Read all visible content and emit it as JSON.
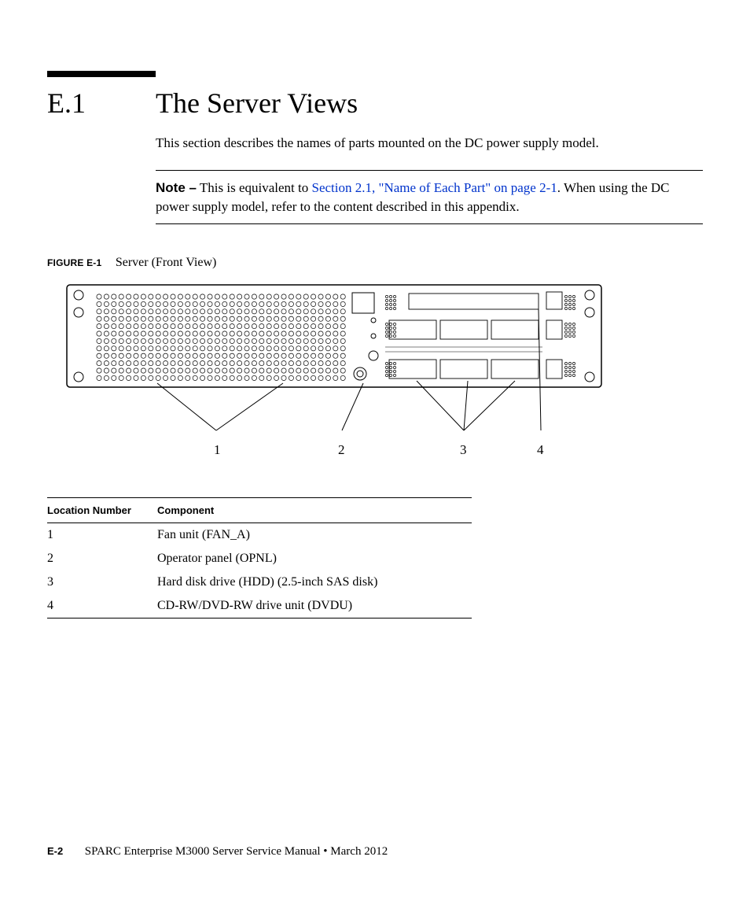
{
  "section": {
    "number": "E.1",
    "title": "The Server Views",
    "intro": "This section describes the names of parts mounted on the DC power supply model."
  },
  "note": {
    "label": "Note –",
    "pre": " This is equivalent to ",
    "link": "Section 2.1, \"Name of Each Part\" on page 2-1",
    "post": ". When using the DC power supply model, refer to the content described in this appendix."
  },
  "figure": {
    "label": "FIGURE E-1",
    "title": "Server (Front View)",
    "callouts": [
      "1",
      "2",
      "3",
      "4"
    ]
  },
  "table": {
    "headers": [
      "Location Number",
      "Component"
    ],
    "rows": [
      [
        "1",
        "Fan unit (FAN_A)"
      ],
      [
        "2",
        "Operator panel (OPNL)"
      ],
      [
        "3",
        "Hard disk drive (HDD) (2.5-inch SAS disk)"
      ],
      [
        "4",
        "CD-RW/DVD-RW drive unit (DVDU)"
      ]
    ]
  },
  "footer": {
    "page": "E-2",
    "text": "SPARC Enterprise M3000 Server Service Manual  •  March 2012"
  }
}
